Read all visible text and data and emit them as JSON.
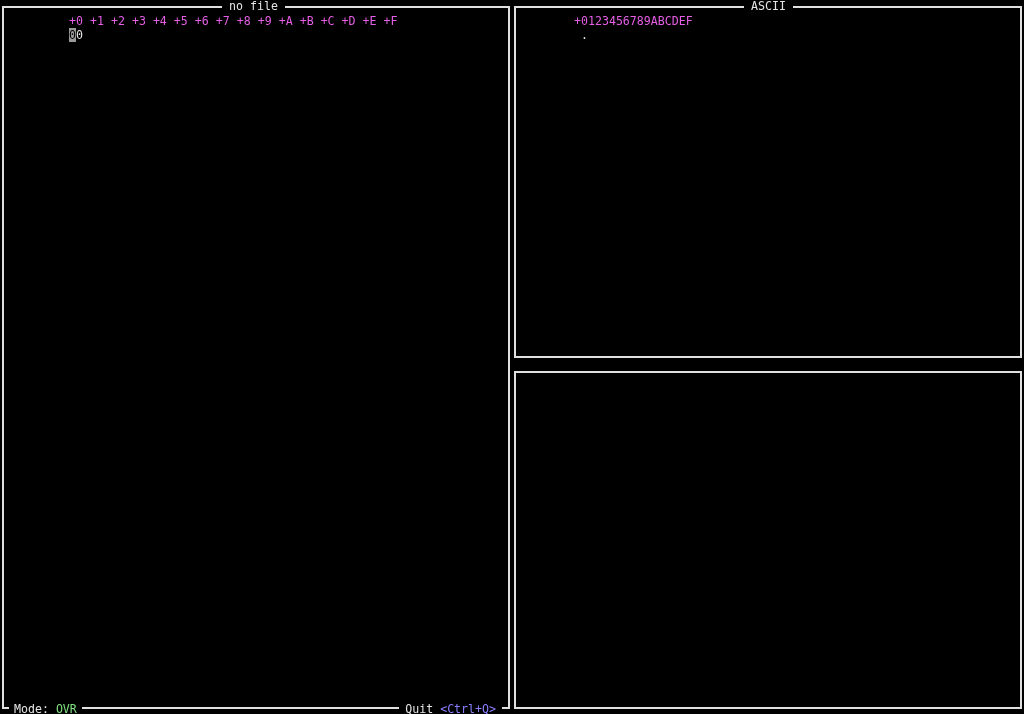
{
  "hex_panel": {
    "title": "no file",
    "columns": [
      "+0",
      "+1",
      "+2",
      "+3",
      "+4",
      "+5",
      "+6",
      "+7",
      "+8",
      "+9",
      "+A",
      "+B",
      "+C",
      "+D",
      "+E",
      "+F"
    ],
    "rows": [
      {
        "cells": [
          {
            "value": "00",
            "cursor": true
          }
        ]
      }
    ],
    "mode_label": "Mode:",
    "mode": "OVR",
    "quit_label": "Quit",
    "quit_key": "<Ctrl+Q>"
  },
  "ascii_panel": {
    "title": "ASCII",
    "header": "+0123456789ABCDEF",
    "rows": [
      "."
    ]
  }
}
